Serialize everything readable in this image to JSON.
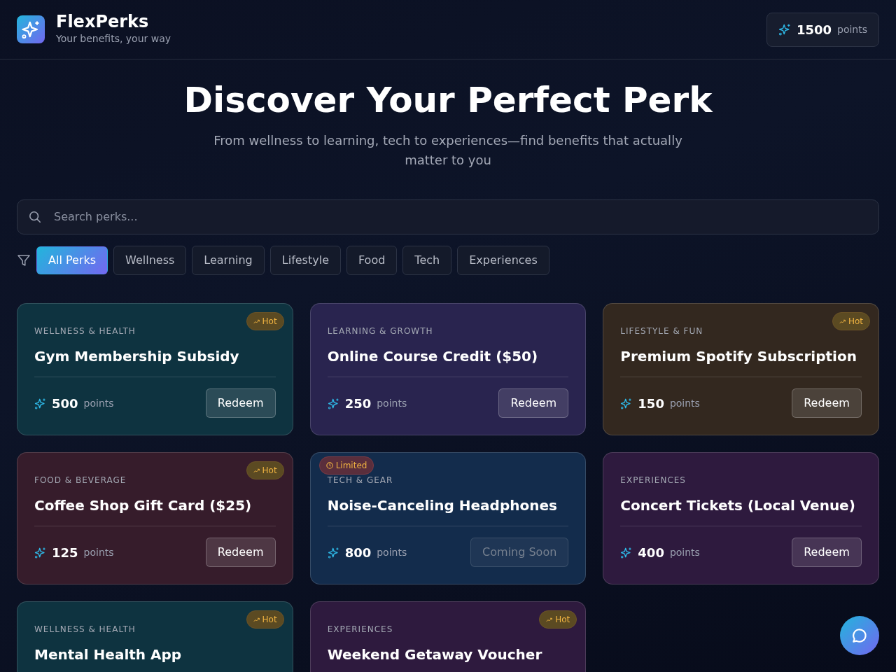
{
  "brand": {
    "name": "FlexPerks",
    "tagline": "Your benefits, your way"
  },
  "balance": {
    "value": "1500",
    "unit": "points"
  },
  "hero": {
    "title": "Discover Your Perfect Perk",
    "subtitle": "From wellness to learning, tech to experiences—find benefits that actually matter to you"
  },
  "search": {
    "placeholder": "Search perks..."
  },
  "filters": [
    {
      "label": "All Perks",
      "selected": true
    },
    {
      "label": "Wellness",
      "selected": false
    },
    {
      "label": "Learning",
      "selected": false
    },
    {
      "label": "Lifestyle",
      "selected": false
    },
    {
      "label": "Food",
      "selected": false
    },
    {
      "label": "Tech",
      "selected": false
    },
    {
      "label": "Experiences",
      "selected": false
    }
  ],
  "perks": [
    {
      "category": "WELLNESS & HEALTH",
      "title": "Gym Membership Subsidy",
      "points": "500",
      "unit": "points",
      "color": "#0e3340",
      "badge": {
        "kind": "hot",
        "label": "Hot"
      },
      "button": {
        "label": "Redeem",
        "disabled": false
      }
    },
    {
      "category": "LEARNING & GROWTH",
      "title": "Online Course Credit ($50)",
      "points": "250",
      "unit": "points",
      "color": "#29244f",
      "button": {
        "label": "Redeem",
        "disabled": false
      }
    },
    {
      "category": "LIFESTYLE & FUN",
      "title": "Premium Spotify Subscription",
      "points": "150",
      "unit": "points",
      "color": "#33281f",
      "badge": {
        "kind": "hot",
        "label": "Hot"
      },
      "button": {
        "label": "Redeem",
        "disabled": false
      }
    },
    {
      "category": "FOOD & BEVERAGE",
      "title": "Coffee Shop Gift Card ($25)",
      "points": "125",
      "unit": "points",
      "color": "#361c2b",
      "badge": {
        "kind": "hot",
        "label": "Hot"
      },
      "button": {
        "label": "Redeem",
        "disabled": false
      }
    },
    {
      "category": "TECH & GEAR",
      "title": "Noise-Canceling Headphones",
      "points": "800",
      "unit": "points",
      "color": "#132c4c",
      "badge": {
        "kind": "limited",
        "label": "Limited"
      },
      "button": {
        "label": "Coming Soon",
        "disabled": true
      }
    },
    {
      "category": "EXPERIENCES",
      "title": "Concert Tickets (Local Venue)",
      "points": "400",
      "unit": "points",
      "color": "#2e1a3e",
      "button": {
        "label": "Redeem",
        "disabled": false
      }
    },
    {
      "category": "WELLNESS & HEALTH",
      "title": "Mental Health App",
      "color": "#0e3340",
      "badge": {
        "kind": "hot",
        "label": "Hot"
      }
    },
    {
      "category": "EXPERIENCES",
      "title": "Weekend Getaway Voucher",
      "color": "#2e1a3e",
      "badge": {
        "kind": "hot",
        "label": "Hot"
      }
    }
  ]
}
